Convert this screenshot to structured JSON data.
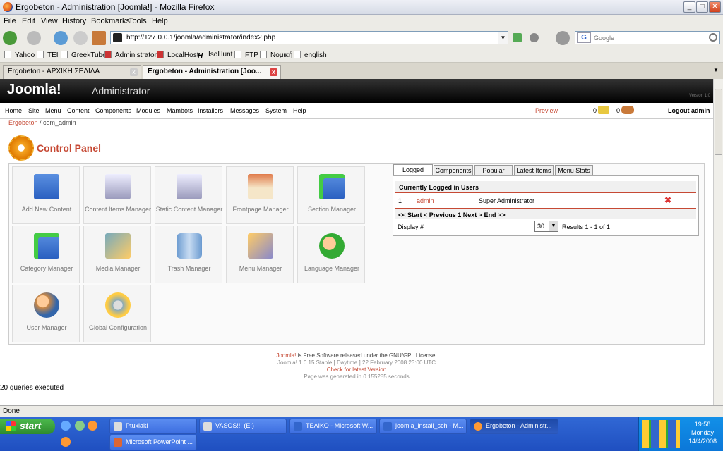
{
  "window": {
    "title": "Ergobeton - Administration [Joomla!] - Mozilla Firefox"
  },
  "menubar": [
    "File",
    "Edit",
    "View",
    "History",
    "Bookmarks",
    "Tools",
    "Help"
  ],
  "navbar": {
    "url": "http://127.0.0.1/joomla/administrator/index2.php",
    "search_placeholder": "Google",
    "search_engine": "G"
  },
  "bookmarks": [
    "Yahoo",
    "TEI",
    "GreekTube",
    "Administrator",
    "LocalHost",
    "IsoHunt",
    "FTP",
    "Νομική",
    "english"
  ],
  "tabs": [
    {
      "label": "Ergobeton - ΑΡΧΙΚΗ ΣΕΛΙΔΑ"
    },
    {
      "label": "Ergobeton - Administration [Joo..."
    }
  ],
  "joomla": {
    "logo": "Joomla!",
    "admin_label": "Administrator",
    "version": "Version 1.0",
    "menu": [
      "Home",
      "Site",
      "Menu",
      "Content",
      "Components",
      "Modules",
      "Mambots",
      "Installers",
      "Messages",
      "System",
      "Help"
    ],
    "preview": "Preview",
    "msg_count": "0",
    "users_count": "0",
    "logout": "Logout admin",
    "breadcrumb_site": "Ergobeton",
    "breadcrumb_rest": " / com_admin",
    "page_title": "Control Panel"
  },
  "quickicons": [
    {
      "label": "Add New Content",
      "icon": "add-content-icon"
    },
    {
      "label": "Content Items Manager",
      "icon": "content-items-icon"
    },
    {
      "label": "Static Content Manager",
      "icon": "static-content-icon"
    },
    {
      "label": "Frontpage Manager",
      "icon": "frontpage-icon"
    },
    {
      "label": "Section Manager",
      "icon": "section-icon"
    },
    {
      "label": "Category Manager",
      "icon": "category-icon"
    },
    {
      "label": "Media Manager",
      "icon": "media-icon"
    },
    {
      "label": "Trash Manager",
      "icon": "trash-icon"
    },
    {
      "label": "Menu Manager",
      "icon": "menu-icon"
    },
    {
      "label": "Language Manager",
      "icon": "language-icon"
    },
    {
      "label": "User Manager",
      "icon": "user-icon"
    },
    {
      "label": "Global Configuration",
      "icon": "config-icon"
    }
  ],
  "right_tabs": [
    "Logged",
    "Components",
    "Popular",
    "Latest Items",
    "Menu Stats"
  ],
  "logged": {
    "heading": "Currently Logged in Users",
    "row_num": "1",
    "row_user": "admin",
    "row_group": "Super Administrator",
    "pagination": "<< Start < Previous 1 Next > End >>",
    "display_label": "Display #",
    "display_value": "30",
    "results": "Results 1 - 1 of 1"
  },
  "footer": {
    "joomla_link": "Joomla!",
    "license": " is Free Software released under the GNU/GPL License.",
    "version_line": "Joomla! 1.0.15 Stable [ Daytime ] 22 February 2008 23:00 UTC",
    "check": "Check for latest Version",
    "generated": "Page was generated in 0.155285 seconds"
  },
  "queries": "20 queries executed",
  "status": "Done",
  "taskbar": {
    "start": "start",
    "tasks": [
      "Ptuxiaki",
      "VASOS!!! (E:)",
      "ΤΕΛΙΚΟ - Microsoft W...",
      "joomla_install_sch - M...",
      "Ergobeton - Administr...",
      "Microsoft PowerPoint ..."
    ],
    "time": "19:58",
    "day": "Monday",
    "date": "14/4/2008"
  }
}
